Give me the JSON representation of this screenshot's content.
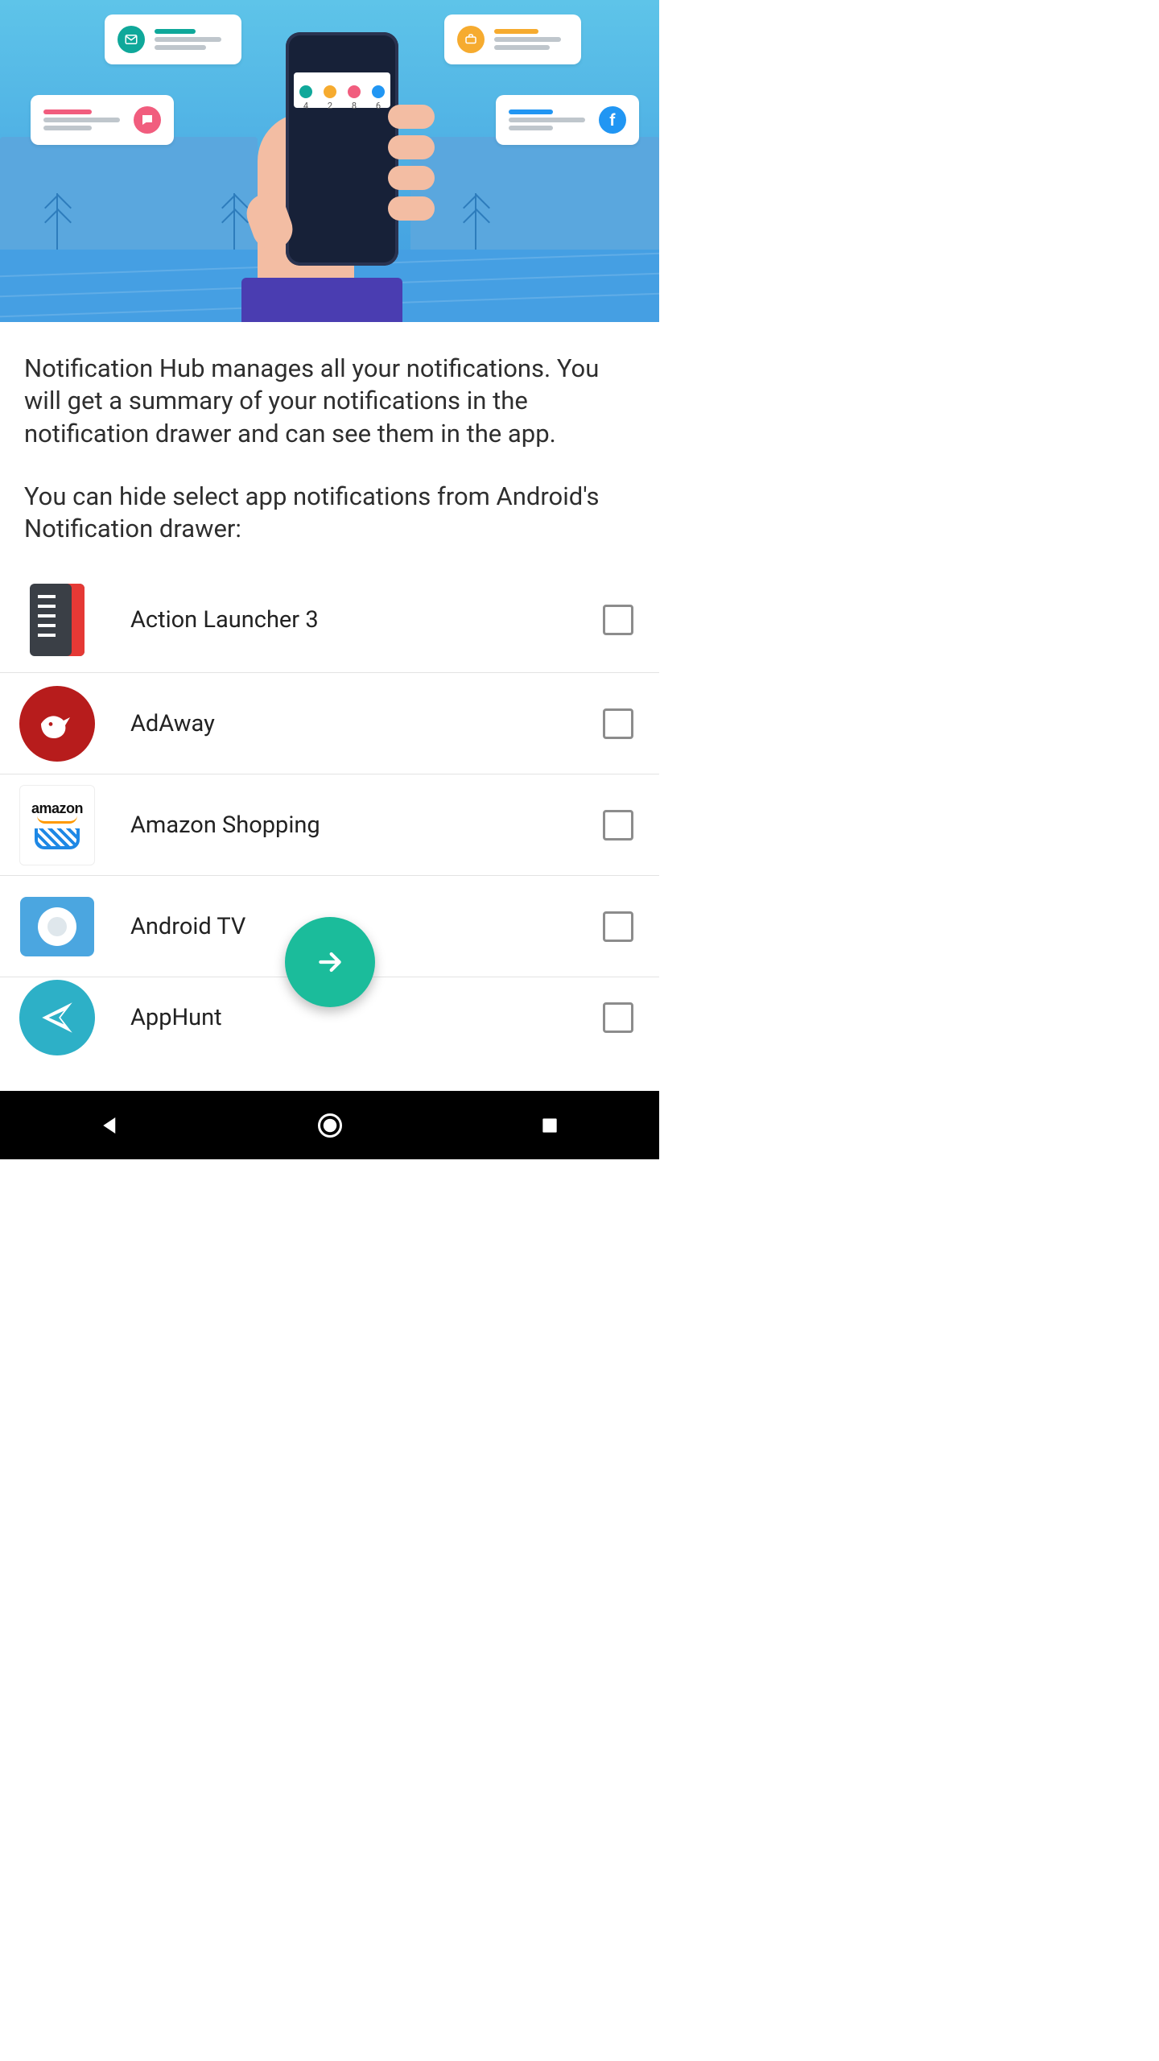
{
  "colors": {
    "accent": "#1bbc9b",
    "checkbox_border": "#8c8c8c"
  },
  "hero": {
    "phone_counts": [
      4,
      2,
      8,
      6
    ],
    "phone_icon_colors": [
      "#0fa89a",
      "#f6ab2f",
      "#f15d7e",
      "#2196f3"
    ],
    "bubble_icons": [
      "mail-icon",
      "chat-icon",
      "briefcase-icon",
      "f-icon"
    ]
  },
  "intro": {
    "p1": "Notification Hub manages all your notifications. You will get a summary of your notifications in the notification drawer and can see them in the app.",
    "p2": "You can hide select app notifications from Android's Notification drawer:"
  },
  "apps": [
    {
      "name": "Action Launcher 3",
      "icon": "action-launcher-icon",
      "checked": false
    },
    {
      "name": "AdAway",
      "icon": "adaway-icon",
      "checked": false
    },
    {
      "name": "Amazon Shopping",
      "icon": "amazon-shopping-icon",
      "checked": false
    },
    {
      "name": "Android TV",
      "icon": "android-tv-icon",
      "checked": false
    },
    {
      "name": "AppHunt",
      "icon": "apphunt-icon",
      "checked": false
    }
  ],
  "amazon_label": "amazon",
  "fab": {
    "icon": "arrow-right-icon"
  },
  "nav": {
    "back": "back-icon",
    "home": "home-icon",
    "recent": "recent-apps-icon"
  }
}
